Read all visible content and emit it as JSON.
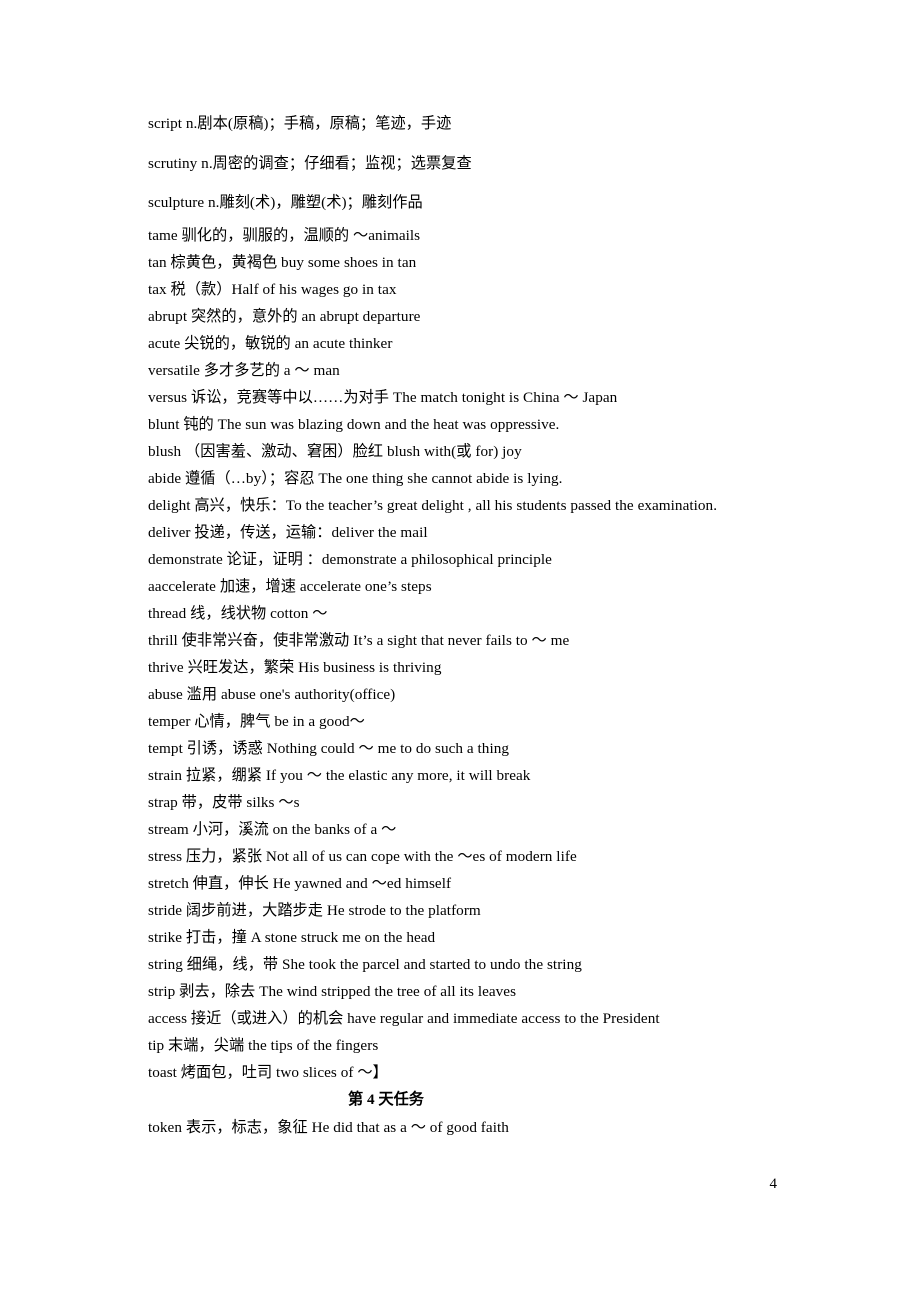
{
  "document": {
    "page_number": "4",
    "day_header": "第 4 天任务"
  },
  "entries": [
    {
      "text": "script n.剧本(原稿)；手稿，原稿；笔迹，手迹",
      "spacing": "loose"
    },
    {
      "text": "scrutiny n.周密的调查；仔细看；监视；选票复查",
      "spacing": "loose"
    },
    {
      "text": "sculpture n.雕刻(术)，雕塑(术)；雕刻作品",
      "spacing": "loose-last"
    },
    {
      "text": "tame  驯化的，驯服的，温顺的 〜animails",
      "spacing": "normal"
    },
    {
      "text": "tan 棕黄色，黄褐色  buy some shoes in tan",
      "spacing": "normal"
    },
    {
      "text": "tax  税（款）Half of his wages go in tax",
      "spacing": "normal"
    },
    {
      "text": "abrupt   突然的，意外的   an abrupt departure",
      "spacing": "normal"
    },
    {
      "text": "acute   尖锐的，敏锐的   an acute thinker",
      "spacing": "normal"
    },
    {
      "text": "versatile  多才多艺的 a 〜 man",
      "spacing": "normal"
    },
    {
      "text": "versus  诉讼，竞赛等中以……为对手 The match tonight is China 〜 Japan",
      "spacing": "normal"
    },
    {
      "text": "blunt   钝的   The sun was blazing down and the heat was oppressive.",
      "spacing": "normal"
    },
    {
      "text": "blush   （因害羞、激动、窘困）脸红   blush with(或 for) joy",
      "spacing": "normal"
    },
    {
      "text": "abide   遵循（…by）；容忍   The one thing she cannot abide is lying.",
      "spacing": "normal"
    },
    {
      "text": "delight 高兴，快乐：To the teacher’s great delight , all his students passed the examination.",
      "spacing": "normal"
    },
    {
      "text": "deliver 投递，传送，运输：deliver the mail",
      "spacing": "normal"
    },
    {
      "text": "demonstrate 论证，证明 ：demonstrate a philosophical principle",
      "spacing": "normal"
    },
    {
      "text": "aaccelerate   加速，增速   accelerate one’s steps",
      "spacing": "normal"
    },
    {
      "text": "thread 线，线状物 cotton 〜",
      "spacing": "normal"
    },
    {
      "text": "thrill 使非常兴奋，使非常激动 It’s a sight that never fails to 〜 me",
      "spacing": "normal"
    },
    {
      "text": "thrive 兴旺发达，繁荣 His business is thriving",
      "spacing": "normal"
    },
    {
      "text": "abuse   滥用   abuse one's authority(office)",
      "spacing": "normal"
    },
    {
      "text": "temper 心情，脾气 be in a good〜",
      "spacing": "normal"
    },
    {
      "text": "tempt 引诱，诱惑 Nothing could 〜 me to do such a thing",
      "spacing": "normal"
    },
    {
      "text": "strain 拉紧，绷紧 If you 〜 the elastic any more, it will break",
      "spacing": "normal"
    },
    {
      "text": "strap 带，皮带 silks 〜s",
      "spacing": "normal"
    },
    {
      "text": "stream 小河，溪流 on the banks of a 〜",
      "spacing": "normal"
    },
    {
      "text": "stress 压力，紧张 Not all of us can cope with the 〜es of modern life",
      "spacing": "normal"
    },
    {
      "text": "stretch 伸直，伸长 He yawned and 〜ed himself",
      "spacing": "normal"
    },
    {
      "text": "stride 阔步前进，大踏步走 He strode to the platform",
      "spacing": "normal"
    },
    {
      "text": "strike 打击，撞   A stone struck me on the head",
      "spacing": "normal"
    },
    {
      "text": "string 细绳，线，带 She took the parcel and started to undo the string",
      "spacing": "normal"
    },
    {
      "text": "strip 剥去，除去 The wind stripped the tree of all its leaves",
      "spacing": "normal"
    },
    {
      "text": "access   接近（或进入）的机会   have regular and immediate access to the President",
      "spacing": "normal"
    },
    {
      "text": "tip 末端，尖端 the tips of the fingers",
      "spacing": "normal"
    },
    {
      "text": "toast 烤面包，吐司 two slices of 〜】",
      "spacing": "normal"
    }
  ],
  "entries_after_header": [
    {
      "text": "token 表示，标志，象征 He did that as a 〜 of good faith",
      "spacing": "normal"
    }
  ]
}
